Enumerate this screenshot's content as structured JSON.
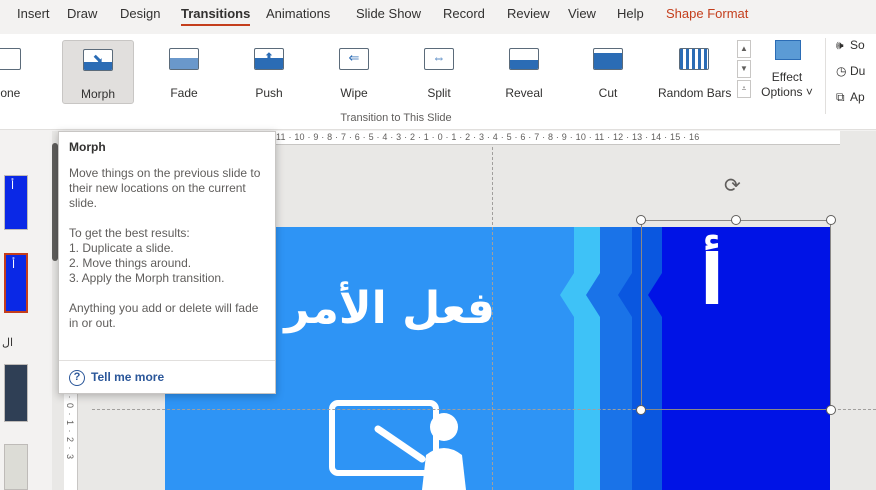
{
  "tabs": {
    "insert": "Insert",
    "draw": "Draw",
    "design": "Design",
    "transitions": "Transitions",
    "animations": "Animations",
    "slideshow": "Slide Show",
    "record": "Record",
    "review": "Review",
    "view": "View",
    "help": "Help",
    "shape_format": "Shape Format"
  },
  "ribbon": {
    "transitions": [
      {
        "label": "None",
        "icon": "none-transition-icon"
      },
      {
        "label": "Morph",
        "icon": "morph-transition-icon",
        "selected": true
      },
      {
        "label": "Fade",
        "icon": "fade-transition-icon"
      },
      {
        "label": "Push",
        "icon": "push-transition-icon"
      },
      {
        "label": "Wipe",
        "icon": "wipe-transition-icon"
      },
      {
        "label": "Split",
        "icon": "split-transition-icon"
      },
      {
        "label": "Reveal",
        "icon": "reveal-transition-icon"
      },
      {
        "label": "Cut",
        "icon": "cut-transition-icon"
      },
      {
        "label": "Random Bars",
        "icon": "random-bars-transition-icon"
      }
    ],
    "effect_options_label": "Effect Options ˅",
    "group_label": "Transition to This Slide",
    "timing": {
      "sound": "So",
      "duration": "Du",
      "apply": "Ap"
    }
  },
  "tooltip": {
    "title": "Morph",
    "paragraph1": "Move things on the previous slide to their new locations on the current slide.",
    "paragraph2_lines": [
      "To get the best results:",
      "1. Duplicate a slide.",
      "2. Move things around.",
      "3. Apply the Morph transition."
    ],
    "paragraph3": "Anything you add or delete will fade in or out.",
    "help_link": "Tell me more"
  },
  "ruler": {
    "horizontal": "11 · 10 · 9 · 8 · 7 · 6 · 5 · 4 · 3 · 2 · 1 · 0 · 1 · 2 · 3 · 4 · 5 · 6 · 7 · 8 · 9 · 10 · 11 · 12 · 13 · 14 · 15 · 16",
    "vertical": "1 · 0 · 1 · 2 · 3"
  },
  "thumbnails": {
    "thumb1_glyph": "أ",
    "thumb2_glyph": "أ",
    "num_label": "ال"
  },
  "slide": {
    "title": "فعل الأمر",
    "letter": "أ",
    "bg_color": "#2e94f5",
    "chevron_colors": [
      "#3ec2f7",
      "#1a73e8",
      "#0a57e0",
      "#0013e6"
    ],
    "picture_icon": "teacher-at-board-icon"
  },
  "colors": {
    "accent": "#c43e1c",
    "link": "#2b579a"
  }
}
